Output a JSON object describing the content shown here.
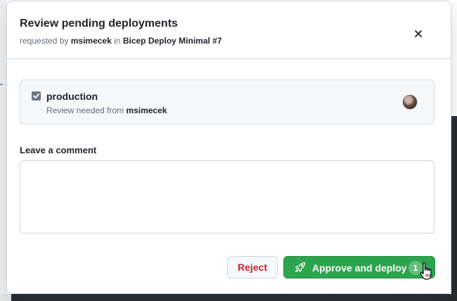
{
  "dialog": {
    "title": "Review pending deployments",
    "subtitle": {
      "requested_by_prefix": "requested by",
      "user": "msimecek",
      "in_text": "in",
      "workflow": "Bicep Deploy Minimal #7"
    },
    "close_icon": "close-icon"
  },
  "environments": [
    {
      "name": "production",
      "checked": true,
      "review_prefix": "Review needed from",
      "reviewer": "msimecek"
    }
  ],
  "comment": {
    "label": "Leave a comment",
    "value": "",
    "placeholder": ""
  },
  "actions": {
    "reject_label": "Reject",
    "approve_label": "Approve and deploy",
    "approve_count": "1",
    "approve_icon": "rocket-icon"
  },
  "colors": {
    "approve_bg": "#2da44e",
    "reject_text": "#cf222e",
    "border": "#d0d7de"
  }
}
